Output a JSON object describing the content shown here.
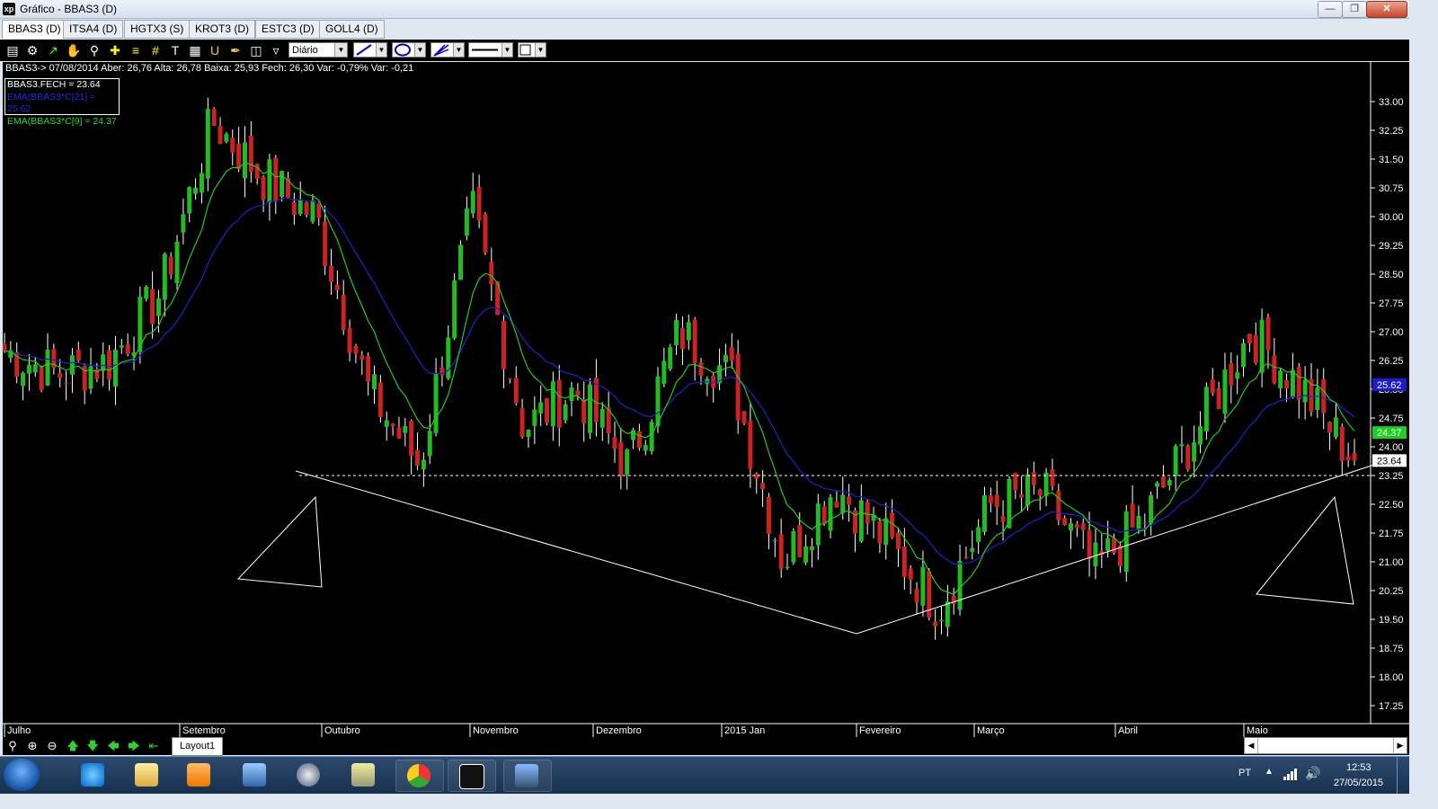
{
  "window": {
    "logo": "xp",
    "title": "Gráfico - BBAS3 (D)"
  },
  "tabs": [
    "BBAS3 (D)",
    "ITSA4 (D)",
    "HGTX3 (S)",
    "KROT3 (D)",
    "ESTC3 (D)",
    "GOLL4 (D)"
  ],
  "toolbar": {
    "period": "Diário",
    "icons": [
      "chart-type-icon",
      "settings-gear-icon",
      "indicator-icon",
      "hand-pan-icon",
      "magnifier-icon",
      "crosshair-icon",
      "fibonacci-icon",
      "grid-icon",
      "text-icon",
      "calculator-icon",
      "magnet-icon",
      "brush-icon",
      "save-icon",
      "filter-icon"
    ]
  },
  "chart": {
    "info_line": "BBAS3-> 07/08/2014 Aber: 26,76 Alta: 26,78 Baixa: 25,93 Fech: 26,30 Var: -0,79% Var: -0,21",
    "legend": [
      {
        "text": "BBAS3.FECH = 23.64",
        "color": "#ffffff"
      },
      {
        "text": "EMA(BBAS3*C[21] = 25.62",
        "color": "#2626e6"
      },
      {
        "text": "EMA(BBAS3*C[9] = 24.37",
        "color": "#22dd22"
      }
    ],
    "y_ticks": [
      "33.00",
      "32.25",
      "31.50",
      "30.75",
      "30.00",
      "29.25",
      "28.50",
      "27.75",
      "27.00",
      "26.25",
      "25.50",
      "24.75",
      "24.00",
      "23.25",
      "22.50",
      "21.75",
      "21.00",
      "20.25",
      "19.50",
      "18.75",
      "18.00",
      "17.25"
    ],
    "x_labels": [
      "Julho",
      "Setembro",
      "Outubro",
      "Novembro",
      "Dezembro",
      "2015 Jan",
      "Fevereiro",
      "Março",
      "Abril",
      "Maio"
    ],
    "price_tags": [
      {
        "value": "25.62",
        "color": "#1b1bd0"
      },
      {
        "value": "24.37",
        "color": "#22cc22"
      },
      {
        "value": "23.64",
        "color": "#ffffff"
      }
    ],
    "colors": {
      "up": "#22bb22",
      "down": "#cc2222",
      "ema21": "#2222cc",
      "ema9": "#22cc22",
      "trendline": "#ffffff"
    },
    "last_close": 23.64
  },
  "chart_data": {
    "type": "candlestick",
    "title": "BBAS3 (D)",
    "ylim": [
      17.0,
      33.4
    ],
    "dates": [
      "2014-07",
      "2014-09",
      "2014-10",
      "2014-11",
      "2014-12",
      "2015-01",
      "2015-02",
      "2015-03",
      "2015-04",
      "2015-05"
    ],
    "ohlc_close_path": [
      {
        "date": "2014-07-01",
        "close": 26.5
      },
      {
        "date": "2014-07-15",
        "close": 25.9
      },
      {
        "date": "2014-08-01",
        "close": 26.2
      },
      {
        "date": "2014-08-15",
        "close": 28.0
      },
      {
        "date": "2014-08-25",
        "close": 32.5
      },
      {
        "date": "2014-09-01",
        "close": 31.0
      },
      {
        "date": "2014-09-15",
        "close": 30.0
      },
      {
        "date": "2014-10-01",
        "close": 25.5
      },
      {
        "date": "2014-10-10",
        "close": 23.5
      },
      {
        "date": "2014-10-20",
        "close": 30.2
      },
      {
        "date": "2014-11-01",
        "close": 24.5
      },
      {
        "date": "2014-11-15",
        "close": 25.5
      },
      {
        "date": "2014-11-25",
        "close": 23.5
      },
      {
        "date": "2014-12-01",
        "close": 27.0
      },
      {
        "date": "2014-12-10",
        "close": 25.8
      },
      {
        "date": "2014-12-20",
        "close": 21.0
      },
      {
        "date": "2015-01-05",
        "close": 23.0
      },
      {
        "date": "2015-01-20",
        "close": 21.5
      },
      {
        "date": "2015-02-02",
        "close": 19.8
      },
      {
        "date": "2015-02-15",
        "close": 22.5
      },
      {
        "date": "2015-03-01",
        "close": 22.8
      },
      {
        "date": "2015-03-15",
        "close": 20.8
      },
      {
        "date": "2015-04-01",
        "close": 22.2
      },
      {
        "date": "2015-04-15",
        "close": 24.5
      },
      {
        "date": "2015-05-01",
        "close": 27.0
      },
      {
        "date": "2015-05-15",
        "close": 25.5
      },
      {
        "date": "2015-05-27",
        "close": 23.64
      }
    ],
    "indicators": [
      {
        "name": "EMA(BBAS3*C[21]",
        "last": 25.62
      },
      {
        "name": "EMA(BBAS3*C[9]",
        "last": 24.37
      }
    ],
    "annotations": [
      "neckline dashed at 23.25",
      "head-and-shoulders style trendlines",
      "two triangle drawings"
    ]
  },
  "bottom": {
    "layout_tab": "Layout1"
  },
  "taskbar": {
    "apps": [
      "ie-icon",
      "folder-icon",
      "media-player-icon",
      "network-icon",
      "hp-icon",
      "install-icon",
      "chrome-icon",
      "xp-icon",
      "picture-icon"
    ],
    "lang": "PT",
    "time": "12:53",
    "date": "27/05/2015"
  }
}
